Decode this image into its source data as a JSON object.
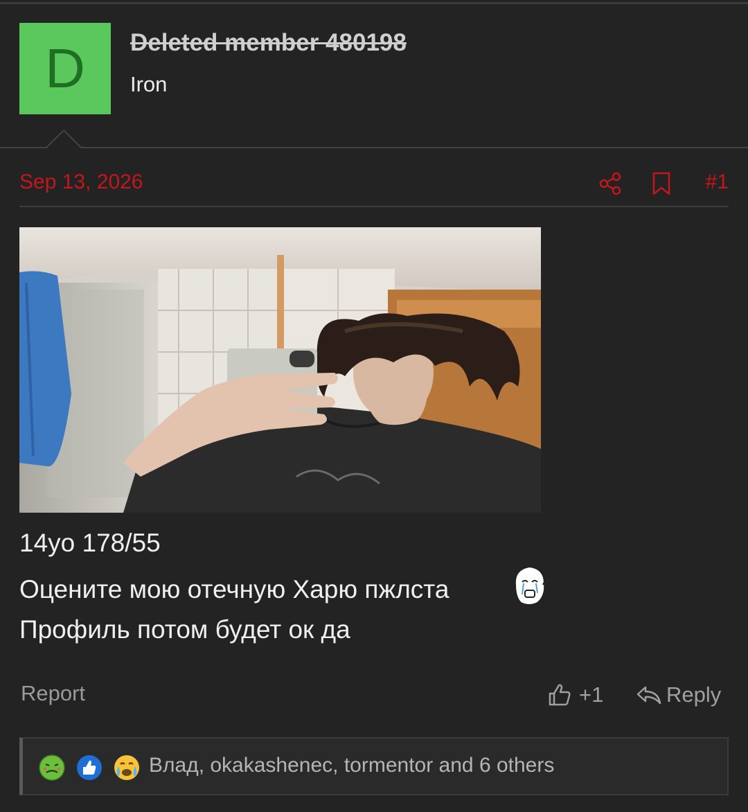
{
  "author": {
    "avatar_letter": "D",
    "name": "Deleted member 480198",
    "title": "Iron",
    "avatar_color": "#5bc85e"
  },
  "post": {
    "date": "Sep 13, 2026",
    "number": "#1",
    "accent_color": "#c4161c",
    "body_lines": [
      "14yo 178/55",
      "Оцените мою отечную Харю пжлста",
      "Профиль потом будет ок да"
    ]
  },
  "actions": {
    "report_label": "Report",
    "like_count": "+1",
    "reply_label": "Reply"
  },
  "reactions": {
    "icons": [
      "nauseated-face-icon",
      "thumbs-up-icon",
      "crying-face-icon"
    ],
    "summary": "Влад, okakashenec, tormentor and 6 others"
  }
}
